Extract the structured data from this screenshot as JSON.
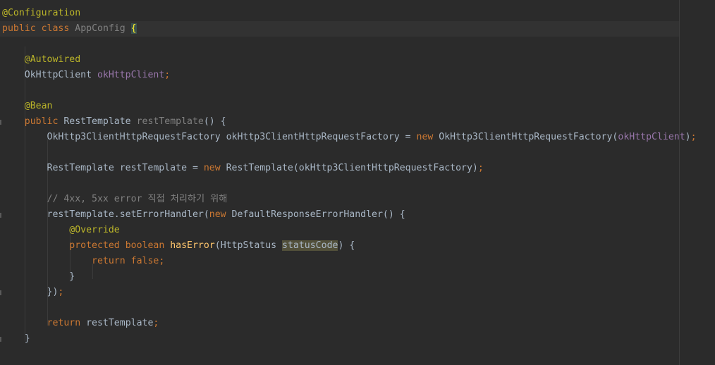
{
  "editor": {
    "lines": [
      {
        "tokens": [
          {
            "t": "@Configuration",
            "c": "ann"
          }
        ]
      },
      {
        "current": true,
        "tokens": [
          {
            "t": "public",
            "c": "kw"
          },
          {
            "t": " "
          },
          {
            "t": "class",
            "c": "kw"
          },
          {
            "t": " "
          },
          {
            "t": "AppConfig",
            "c": "cls-unused"
          },
          {
            "t": " "
          },
          {
            "t": "{",
            "c": "brace-hl"
          }
        ]
      },
      {
        "tokens": []
      },
      {
        "tokens": [
          {
            "t": "    "
          },
          {
            "t": "@Autowired",
            "c": "ann"
          }
        ]
      },
      {
        "tokens": [
          {
            "t": "    OkHttpClient "
          },
          {
            "t": "okHttpClient",
            "c": "fld"
          },
          {
            "t": ";",
            "c": "semi"
          }
        ]
      },
      {
        "tokens": []
      },
      {
        "tokens": [
          {
            "t": "    "
          },
          {
            "t": "@Bean",
            "c": "ann"
          }
        ]
      },
      {
        "gutter": true,
        "tokens": [
          {
            "t": "    "
          },
          {
            "t": "public",
            "c": "kw"
          },
          {
            "t": " RestTemplate "
          },
          {
            "t": "restTemplate",
            "c": "cls-unused"
          },
          {
            "t": "() {"
          }
        ]
      },
      {
        "tokens": [
          {
            "t": "        OkHttp3ClientHttpRequestFactory okHttp3ClientHttpRequestFactory = "
          },
          {
            "t": "new",
            "c": "kw"
          },
          {
            "t": " OkHttp3ClientHttpRequestFactory("
          },
          {
            "t": "okHttpClient",
            "c": "fld"
          },
          {
            "t": ")"
          },
          {
            "t": ";",
            "c": "semi"
          }
        ]
      },
      {
        "tokens": []
      },
      {
        "tokens": [
          {
            "t": "        RestTemplate restTemplate = "
          },
          {
            "t": "new",
            "c": "kw"
          },
          {
            "t": " RestTemplate(okHttp3ClientHttpRequestFactory)"
          },
          {
            "t": ";",
            "c": "semi"
          }
        ]
      },
      {
        "tokens": []
      },
      {
        "tokens": [
          {
            "t": "        "
          },
          {
            "t": "// 4xx, 5xx error 직접 처리하기 위해",
            "c": "cmt"
          }
        ]
      },
      {
        "gutter": true,
        "tokens": [
          {
            "t": "        restTemplate.setErrorHandler("
          },
          {
            "t": "new",
            "c": "kw"
          },
          {
            "t": " DefaultResponseErrorHandler() {"
          }
        ]
      },
      {
        "tokens": [
          {
            "t": "            "
          },
          {
            "t": "@Override",
            "c": "ann"
          }
        ]
      },
      {
        "tokens": [
          {
            "t": "            "
          },
          {
            "t": "protected",
            "c": "kw"
          },
          {
            "t": " "
          },
          {
            "t": "boolean",
            "c": "kw"
          },
          {
            "t": " "
          },
          {
            "t": "hasError",
            "c": "meth"
          },
          {
            "t": "(HttpStatus "
          },
          {
            "t": "statusCode",
            "c": "param-hl"
          },
          {
            "t": ") {"
          }
        ]
      },
      {
        "tokens": [
          {
            "t": "                "
          },
          {
            "t": "return",
            "c": "kw"
          },
          {
            "t": " "
          },
          {
            "t": "false",
            "c": "kw"
          },
          {
            "t": ";",
            "c": "semi"
          }
        ]
      },
      {
        "tokens": [
          {
            "t": "            }"
          }
        ]
      },
      {
        "gutter": true,
        "tokens": [
          {
            "t": "        })"
          },
          {
            "t": ";",
            "c": "semi"
          }
        ]
      },
      {
        "tokens": []
      },
      {
        "tokens": [
          {
            "t": "        "
          },
          {
            "t": "return",
            "c": "kw"
          },
          {
            "t": " restTemplate"
          },
          {
            "t": ";",
            "c": "semi"
          }
        ]
      },
      {
        "gutter": true,
        "tokens": [
          {
            "t": "    }"
          }
        ]
      }
    ]
  }
}
